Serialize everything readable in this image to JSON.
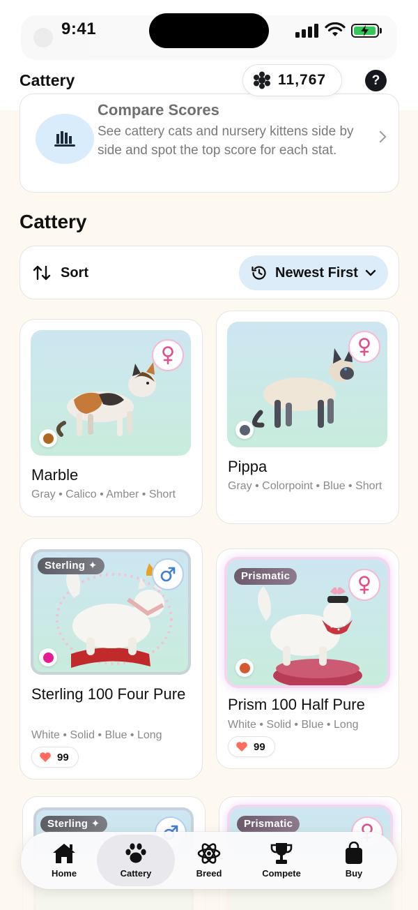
{
  "status_bar": {
    "time": "9:41"
  },
  "header": {
    "title": "Cattery",
    "currency_value": "11,767",
    "currency_icon": "paw-coin-icon",
    "help_label": "?"
  },
  "compare": {
    "title": "Compare Scores",
    "description": "See cattery cats and nursery kittens side by side and spot the top score for each stat.",
    "icon": "bar-chart-icon"
  },
  "section_title": "Cattery",
  "sort": {
    "label": "Sort",
    "value": "Newest First"
  },
  "cats": [
    {
      "name": "Marble",
      "traits": "Gray • Calico • Amber • Short",
      "gender": "female",
      "eye_color": "#b0661e"
    },
    {
      "name": "Pippa",
      "traits": "Gray • Colorpoint • Blue • Short",
      "gender": "female",
      "eye_color": "#5a6170"
    },
    {
      "name": "Sterling 100 Four Pure",
      "badge": "Sterling ✦",
      "traits": "White • Solid • Blue • Long",
      "gender": "male",
      "eye_color": "#e41d93",
      "score": "99"
    },
    {
      "name": "Prism 100 Half Pure",
      "badge": "Prismatic",
      "traits": "White • Solid • Blue • Long",
      "gender": "female",
      "eye_color": "#d25a2c",
      "score": "99"
    },
    {
      "badge": "Sterling ✦",
      "gender": "male"
    },
    {
      "badge": "Prismatic",
      "gender": "female"
    }
  ],
  "nav": {
    "tabs": [
      {
        "label": "Home",
        "icon": "home-icon"
      },
      {
        "label": "Cattery",
        "icon": "paw-icon",
        "active": true
      },
      {
        "label": "Breed",
        "icon": "atom-icon"
      },
      {
        "label": "Compete",
        "icon": "trophy-icon"
      },
      {
        "label": "Buy",
        "icon": "shopping-bag-icon"
      }
    ]
  },
  "colors": {
    "accent_blue": "#dcecf9",
    "female_pink": "#e0508f",
    "male_blue": "#3f7fcf",
    "heart": "#ff6b5c"
  }
}
